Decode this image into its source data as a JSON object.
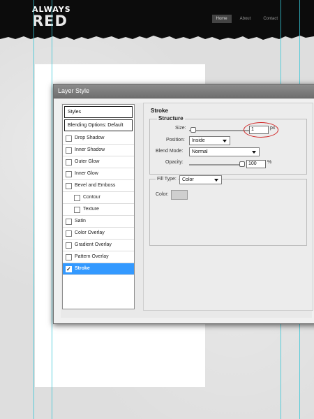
{
  "site": {
    "logo_line1": "ALWAYS",
    "logo_line2": "RED",
    "nav": [
      "Home",
      "About",
      "Contact"
    ]
  },
  "dialog": {
    "title": "Layer Style",
    "style_list": {
      "header": "Styles",
      "blending": "Blending Options: Default",
      "items": [
        {
          "label": "Drop Shadow",
          "checked": false
        },
        {
          "label": "Inner Shadow",
          "checked": false
        },
        {
          "label": "Outer Glow",
          "checked": false
        },
        {
          "label": "Inner Glow",
          "checked": false
        },
        {
          "label": "Bevel and Emboss",
          "checked": false
        },
        {
          "label": "Contour",
          "checked": false
        },
        {
          "label": "Texture",
          "checked": false
        },
        {
          "label": "Satin",
          "checked": false
        },
        {
          "label": "Color Overlay",
          "checked": false
        },
        {
          "label": "Gradient Overlay",
          "checked": false
        },
        {
          "label": "Pattern Overlay",
          "checked": false
        },
        {
          "label": "Stroke",
          "checked": true,
          "selected": true
        }
      ]
    },
    "stroke": {
      "title": "Stroke",
      "structure_title": "Structure",
      "size_label": "Size:",
      "size_value": "1",
      "size_unit": "px",
      "position_label": "Position:",
      "position_value": "Inside",
      "blend_label": "Blend Mode:",
      "blend_value": "Normal",
      "opacity_label": "Opacity:",
      "opacity_value": "100",
      "opacity_unit": "%",
      "opacity_fraction": 1.0,
      "size_fraction": 0.02,
      "fill_type_label": "Fill Type:",
      "fill_type_value": "Color",
      "color_label": "Color:",
      "color_value": "#cfcfcf"
    }
  }
}
